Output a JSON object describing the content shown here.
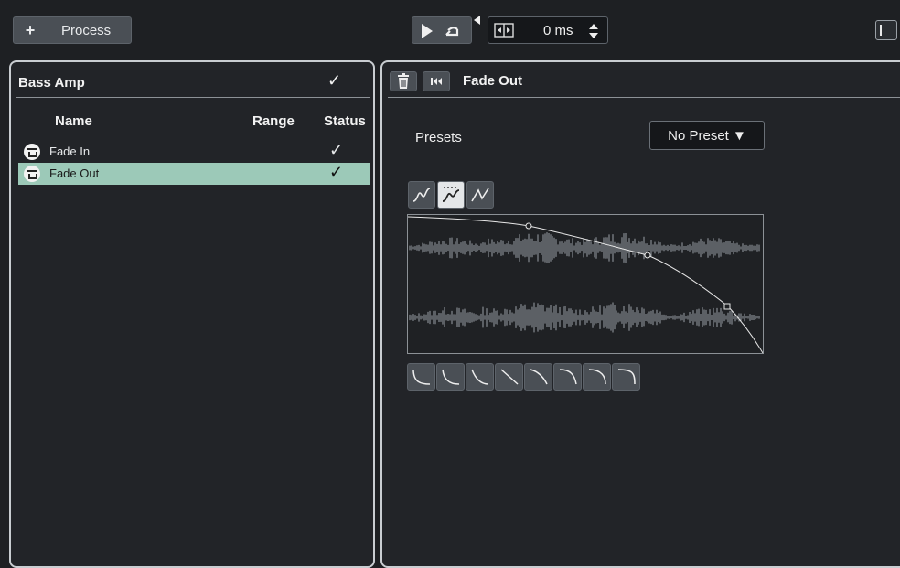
{
  "toolbar": {
    "process_plus": "+",
    "process_label": "Process",
    "offset_value": "0 ms"
  },
  "left_panel": {
    "title": "Bass Amp",
    "title_check": "✓",
    "columns": [
      "Name",
      "Range",
      "Status"
    ],
    "rows": [
      {
        "name": "Fade In",
        "range": "",
        "status": "✓",
        "selected": false
      },
      {
        "name": "Fade Out",
        "range": "",
        "status": "✓",
        "selected": true
      }
    ]
  },
  "right_panel": {
    "title": "Fade Out",
    "presets_label": "Presets",
    "preset_value": "No Preset ▼",
    "curve_modes": [
      "spline-icon",
      "damped-spline-icon",
      "linear-icon"
    ],
    "active_curve_mode": 1,
    "curve_shapes": 8
  },
  "colors": {
    "background": "#1e2023",
    "selection": "#9cc9b8",
    "button": "#4a4f55"
  }
}
